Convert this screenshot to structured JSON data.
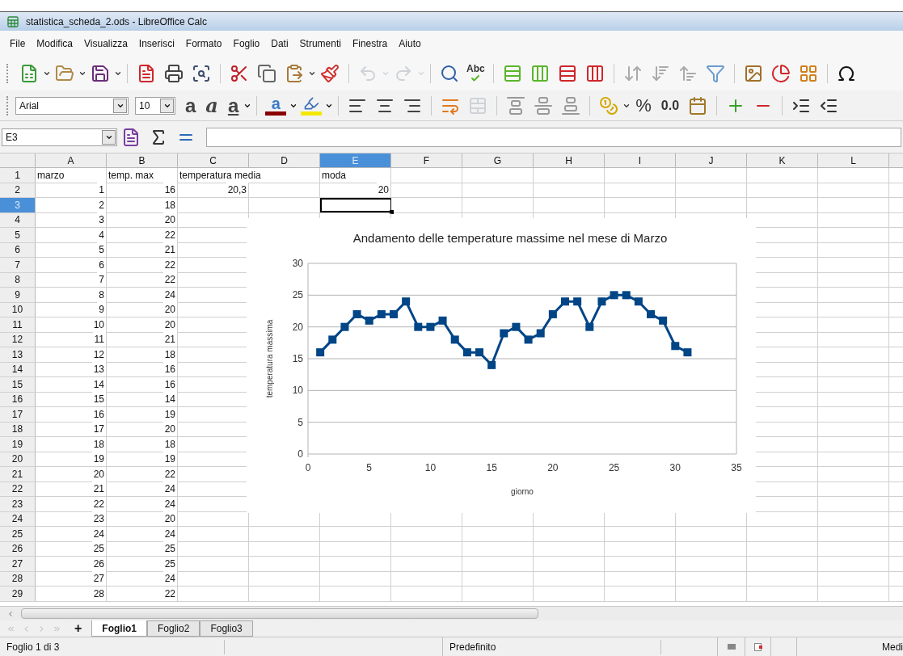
{
  "window": {
    "title": "statistica_scheda_2.ods - LibreOffice Calc"
  },
  "menu": [
    "File",
    "Modifica",
    "Visualizza",
    "Inserisci",
    "Formato",
    "Foglio",
    "Dati",
    "Strumenti",
    "Finestra",
    "Aiuto"
  ],
  "toolbar": {
    "undo": {
      "disabled": true
    },
    "redo": {
      "disabled": true
    },
    "merge": {
      "disabled": true
    },
    "spellcheck_label": "Abc"
  },
  "formatting": {
    "font_name": "Arial",
    "font_size": "10",
    "bold": "a",
    "italic": "a",
    "underline": "a",
    "font_color": "a",
    "percent": "%",
    "number_format": "0.0"
  },
  "formula_bar": {
    "name_box": "E3"
  },
  "columns": [
    {
      "label": "A",
      "selected": false
    },
    {
      "label": "B",
      "selected": false
    },
    {
      "label": "C",
      "selected": false
    },
    {
      "label": "D",
      "selected": false
    },
    {
      "label": "E",
      "selected": true
    },
    {
      "label": "F",
      "selected": false
    },
    {
      "label": "G",
      "selected": false
    },
    {
      "label": "H",
      "selected": false
    },
    {
      "label": "I",
      "selected": false
    },
    {
      "label": "J",
      "selected": false
    },
    {
      "label": "K",
      "selected": false
    },
    {
      "label": "L",
      "selected": false
    }
  ],
  "rows": [
    {
      "number": "1",
      "selected": false,
      "kind": "labels",
      "cells": {
        "a": "marzo",
        "b": "temp. max",
        "c": "temperatura media",
        "e": "moda"
      }
    },
    {
      "number": "2",
      "selected": false,
      "kind": "numbers",
      "cells": {
        "a": "1",
        "b": "16",
        "c": "20,3",
        "e": "20"
      }
    },
    {
      "number": "3",
      "selected": true,
      "kind": "numbers",
      "cells": {
        "a": "2",
        "b": "18"
      }
    },
    {
      "number": "4",
      "selected": false,
      "kind": "numbers",
      "cells": {
        "a": "3",
        "b": "20"
      }
    },
    {
      "number": "5",
      "selected": false,
      "kind": "numbers",
      "cells": {
        "a": "4",
        "b": "22"
      }
    },
    {
      "number": "6",
      "selected": false,
      "kind": "numbers",
      "cells": {
        "a": "5",
        "b": "21"
      }
    },
    {
      "number": "7",
      "selected": false,
      "kind": "numbers",
      "cells": {
        "a": "6",
        "b": "22"
      }
    },
    {
      "number": "8",
      "selected": false,
      "kind": "numbers",
      "cells": {
        "a": "7",
        "b": "22"
      }
    },
    {
      "number": "9",
      "selected": false,
      "kind": "numbers",
      "cells": {
        "a": "8",
        "b": "24"
      }
    },
    {
      "number": "10",
      "selected": false,
      "kind": "numbers",
      "cells": {
        "a": "9",
        "b": "20"
      }
    },
    {
      "number": "11",
      "selected": false,
      "kind": "numbers",
      "cells": {
        "a": "10",
        "b": "20"
      }
    },
    {
      "number": "12",
      "selected": false,
      "kind": "numbers",
      "cells": {
        "a": "11",
        "b": "21"
      }
    },
    {
      "number": "13",
      "selected": false,
      "kind": "numbers",
      "cells": {
        "a": "12",
        "b": "18"
      }
    },
    {
      "number": "14",
      "selected": false,
      "kind": "numbers",
      "cells": {
        "a": "13",
        "b": "16"
      }
    },
    {
      "number": "15",
      "selected": false,
      "kind": "numbers",
      "cells": {
        "a": "14",
        "b": "16"
      }
    },
    {
      "number": "16",
      "selected": false,
      "kind": "numbers",
      "cells": {
        "a": "15",
        "b": "14"
      }
    },
    {
      "number": "17",
      "selected": false,
      "kind": "numbers",
      "cells": {
        "a": "16",
        "b": "19"
      }
    },
    {
      "number": "18",
      "selected": false,
      "kind": "numbers",
      "cells": {
        "a": "17",
        "b": "20"
      }
    },
    {
      "number": "19",
      "selected": false,
      "kind": "numbers",
      "cells": {
        "a": "18",
        "b": "18"
      }
    },
    {
      "number": "20",
      "selected": false,
      "kind": "numbers",
      "cells": {
        "a": "19",
        "b": "19"
      }
    },
    {
      "number": "21",
      "selected": false,
      "kind": "numbers",
      "cells": {
        "a": "20",
        "b": "22"
      }
    },
    {
      "number": "22",
      "selected": false,
      "kind": "numbers",
      "cells": {
        "a": "21",
        "b": "24"
      }
    },
    {
      "number": "23",
      "selected": false,
      "kind": "numbers",
      "cells": {
        "a": "22",
        "b": "24"
      }
    },
    {
      "number": "24",
      "selected": false,
      "kind": "numbers",
      "cells": {
        "a": "23",
        "b": "20"
      }
    },
    {
      "number": "25",
      "selected": false,
      "kind": "numbers",
      "cells": {
        "a": "24",
        "b": "24"
      }
    },
    {
      "number": "26",
      "selected": false,
      "kind": "numbers",
      "cells": {
        "a": "25",
        "b": "25"
      }
    },
    {
      "number": "27",
      "selected": false,
      "kind": "numbers",
      "cells": {
        "a": "26",
        "b": "25"
      }
    },
    {
      "number": "28",
      "selected": false,
      "kind": "numbers",
      "cells": {
        "a": "27",
        "b": "24"
      }
    },
    {
      "number": "29",
      "selected": false,
      "kind": "numbers",
      "cells": {
        "a": "28",
        "b": "22"
      }
    }
  ],
  "chart": {
    "chart_data": {
      "type": "line",
      "title": "Andamento delle temperature massime nel mese di Marzo",
      "xlabel": "giorno",
      "ylabel": "temperatura massima",
      "x": [
        1,
        2,
        3,
        4,
        5,
        6,
        7,
        8,
        9,
        10,
        11,
        12,
        13,
        14,
        15,
        16,
        17,
        18,
        19,
        20,
        21,
        22,
        23,
        24,
        25,
        26,
        27,
        28,
        29,
        30,
        31
      ],
      "grid": true,
      "series": [
        {
          "color": "#004586",
          "marker": "square",
          "values": [
            16,
            18,
            20,
            22,
            21,
            22,
            22,
            24,
            20,
            20,
            21,
            18,
            16,
            16,
            14,
            19,
            20,
            18,
            19,
            22,
            24,
            24,
            20,
            24,
            25,
            25,
            24,
            22,
            21,
            17,
            16
          ]
        }
      ],
      "xlim": [
        0,
        35
      ],
      "ylim": [
        0,
        30
      ],
      "xticks": [
        0,
        5,
        10,
        15,
        20,
        25,
        30,
        35
      ],
      "yticks": [
        0,
        5,
        10,
        15,
        20,
        25,
        30
      ]
    }
  },
  "sheet_tabs": {
    "add": "+",
    "tabs": [
      {
        "label": "Foglio1",
        "selected": true
      },
      {
        "label": "Foglio2",
        "selected": false
      },
      {
        "label": "Foglio3",
        "selected": false
      }
    ]
  },
  "status_bar": {
    "sheet": "Foglio 1 di 3",
    "page_style": "Predefinito",
    "summary": "Medi"
  }
}
